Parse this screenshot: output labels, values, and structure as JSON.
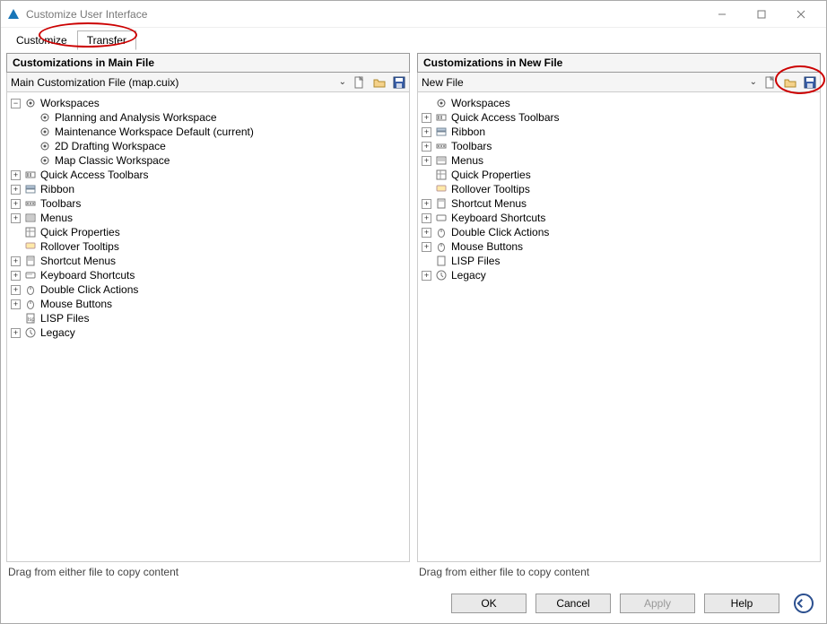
{
  "window": {
    "title": "Customize User Interface"
  },
  "tabs": {
    "customize": "Customize",
    "transfer": "Transfer",
    "active": "transfer"
  },
  "left": {
    "header": "Customizations in Main File",
    "file_label": "Main Customization File (map.cuix)",
    "hint": "Drag from either file to copy content",
    "tree": {
      "workspaces": "Workspaces",
      "ws_items": [
        "Planning and Analysis Workspace",
        "Maintenance Workspace Default (current)",
        "2D Drafting Workspace",
        "Map Classic Workspace"
      ],
      "quick_access": "Quick Access Toolbars",
      "ribbon": "Ribbon",
      "toolbars": "Toolbars",
      "menus": "Menus",
      "quick_props": "Quick Properties",
      "rollover": "Rollover Tooltips",
      "shortcut_menus": "Shortcut Menus",
      "kb_shortcuts": "Keyboard Shortcuts",
      "dbl_click": "Double Click Actions",
      "mouse_buttons": "Mouse Buttons",
      "lisp": "LISP Files",
      "legacy": "Legacy"
    }
  },
  "right": {
    "header": "Customizations in New File",
    "file_label": "New File",
    "hint": "Drag from either file to copy content",
    "tree": {
      "workspaces": "Workspaces",
      "quick_access": "Quick Access Toolbars",
      "ribbon": "Ribbon",
      "toolbars": "Toolbars",
      "menus": "Menus",
      "quick_props": "Quick Properties",
      "rollover": "Rollover Tooltips",
      "shortcut_menus": "Shortcut Menus",
      "kb_shortcuts": "Keyboard Shortcuts",
      "dbl_click": "Double Click Actions",
      "mouse_buttons": "Mouse Buttons",
      "lisp": "LISP Files",
      "legacy": "Legacy"
    }
  },
  "buttons": {
    "ok": "OK",
    "cancel": "Cancel",
    "apply": "Apply",
    "help": "Help"
  },
  "icons": {
    "new": "new-file-icon",
    "open": "open-folder-icon",
    "save": "save-icon"
  }
}
